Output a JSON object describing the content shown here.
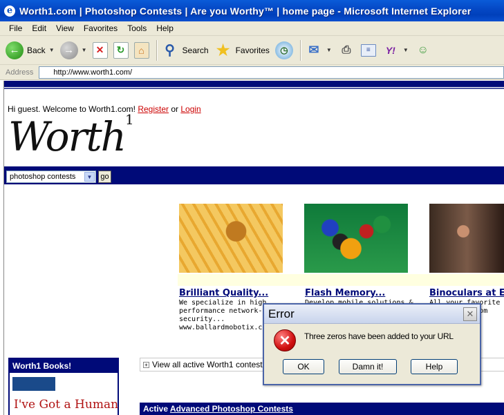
{
  "window": {
    "title": "Worth1.com | Photoshop Contests | Are you Worthy™ | home page - Microsoft Internet Explorer",
    "icon": "ie-icon"
  },
  "menu": [
    "File",
    "Edit",
    "View",
    "Favorites",
    "Tools",
    "Help"
  ],
  "toolbar": {
    "back": "Back",
    "search": "Search",
    "favorites": "Favorites"
  },
  "address": {
    "label": "Address",
    "url": "http://www.worth1.com/"
  },
  "page": {
    "welcome_prefix": "Hi guest. Welcome to Worth1.com!",
    "register": "Register",
    "or": "or",
    "login": "Login",
    "logo_text": "Worth",
    "logo_sup": "1",
    "nav_select": "photoshop contests",
    "go": "go",
    "products": [
      {
        "title": "Brilliant Quality...",
        "desc": "We specialize in high performance network-video security... www.ballardmobotix.co"
      },
      {
        "title": "Flash Memory...",
        "desc": "Develop mobile solutions &"
      },
      {
        "title": "Binoculars at Ea",
        "desc": "All your favorite bin count p cs.com"
      }
    ],
    "view_all": "View all active Worth1 contests",
    "books_title": "Worth1 Books!",
    "book_cover_text": "I've Got a Human",
    "active_prefix": "Active",
    "active_link": "Advanced Photoshop Contests"
  },
  "dialog": {
    "title": "Error",
    "message": "Three zeros have been added to your URL",
    "ok": "OK",
    "damn": "Damn it!",
    "help": "Help"
  }
}
